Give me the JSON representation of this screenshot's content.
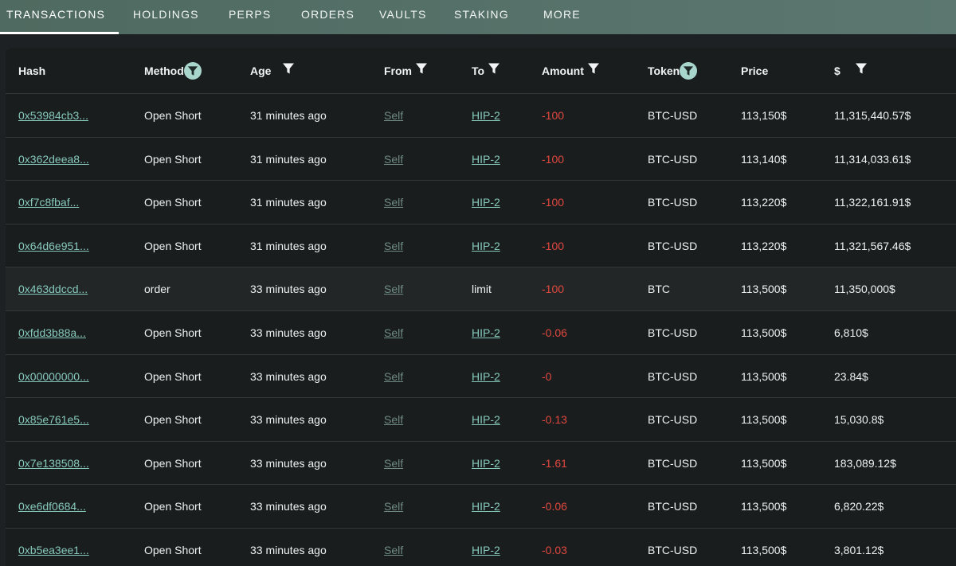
{
  "tabs": [
    {
      "label": "TRANSACTIONS",
      "active": true
    },
    {
      "label": "HOLDINGS",
      "active": false
    },
    {
      "label": "PERPS",
      "active": false
    },
    {
      "label": "ORDERS",
      "active": false
    },
    {
      "label": "VAULTS",
      "active": false
    },
    {
      "label": "STAKING",
      "active": false
    },
    {
      "label": "MORE",
      "active": false
    }
  ],
  "columns": [
    {
      "label": "Hash",
      "filter": "none"
    },
    {
      "label": "Method",
      "filter": "circle"
    },
    {
      "label": "Age",
      "filter": "plain"
    },
    {
      "label": "From",
      "filter": "plain"
    },
    {
      "label": "To",
      "filter": "plain"
    },
    {
      "label": "Amount",
      "filter": "plain"
    },
    {
      "label": "Token",
      "filter": "circle"
    },
    {
      "label": "Price",
      "filter": "none"
    },
    {
      "label": "$",
      "filter": "plain"
    }
  ],
  "rows": [
    {
      "hash": "0x53984cb3...",
      "method": "Open Short",
      "age": "31 minutes ago",
      "from": "Self",
      "to": "HIP-2",
      "to_link": true,
      "amount": "-100",
      "token": "BTC-USD",
      "price": "113,150$",
      "usd": "11,315,440.57$"
    },
    {
      "hash": "0x362deea8...",
      "method": "Open Short",
      "age": "31 minutes ago",
      "from": "Self",
      "to": "HIP-2",
      "to_link": true,
      "amount": "-100",
      "token": "BTC-USD",
      "price": "113,140$",
      "usd": "11,314,033.61$"
    },
    {
      "hash": "0xf7c8fbaf...",
      "method": "Open Short",
      "age": "31 minutes ago",
      "from": "Self",
      "to": "HIP-2",
      "to_link": true,
      "amount": "-100",
      "token": "BTC-USD",
      "price": "113,220$",
      "usd": "11,322,161.91$"
    },
    {
      "hash": "0x64d6e951...",
      "method": "Open Short",
      "age": "31 minutes ago",
      "from": "Self",
      "to": "HIP-2",
      "to_link": true,
      "amount": "-100",
      "token": "BTC-USD",
      "price": "113,220$",
      "usd": "11,321,567.46$"
    },
    {
      "hash": "0x463ddccd...",
      "method": "order",
      "age": "33 minutes ago",
      "from": "Self",
      "to": "limit",
      "to_link": false,
      "amount": "-100",
      "token": "BTC",
      "price": "113,500$",
      "usd": "11,350,000$"
    },
    {
      "hash": "0xfdd3b88a...",
      "method": "Open Short",
      "age": "33 minutes ago",
      "from": "Self",
      "to": "HIP-2",
      "to_link": true,
      "amount": "-0.06",
      "token": "BTC-USD",
      "price": "113,500$",
      "usd": "6,810$"
    },
    {
      "hash": "0x00000000...",
      "method": "Open Short",
      "age": "33 minutes ago",
      "from": "Self",
      "to": "HIP-2",
      "to_link": true,
      "amount": "-0",
      "token": "BTC-USD",
      "price": "113,500$",
      "usd": "23.84$"
    },
    {
      "hash": "0x85e761e5...",
      "method": "Open Short",
      "age": "33 minutes ago",
      "from": "Self",
      "to": "HIP-2",
      "to_link": true,
      "amount": "-0.13",
      "token": "BTC-USD",
      "price": "113,500$",
      "usd": "15,030.8$"
    },
    {
      "hash": "0x7e138508...",
      "method": "Open Short",
      "age": "33 minutes ago",
      "from": "Self",
      "to": "HIP-2",
      "to_link": true,
      "amount": "-1.61",
      "token": "BTC-USD",
      "price": "113,500$",
      "usd": "183,089.12$"
    },
    {
      "hash": "0xe6df0684...",
      "method": "Open Short",
      "age": "33 minutes ago",
      "from": "Self",
      "to": "HIP-2",
      "to_link": true,
      "amount": "-0.06",
      "token": "BTC-USD",
      "price": "113,500$",
      "usd": "6,820.22$"
    },
    {
      "hash": "0xb5ea3ee1...",
      "method": "Open Short",
      "age": "33 minutes ago",
      "from": "Self",
      "to": "HIP-2",
      "to_link": true,
      "amount": "-0.03",
      "token": "BTC-USD",
      "price": "113,500$",
      "usd": "3,801.12$"
    }
  ],
  "colors": {
    "tab_bar": "#557066",
    "link": "#86c9bb",
    "self_link": "#6f8a84",
    "negative": "#e0483f",
    "filter_active": "#a8d6cc"
  },
  "icons": {
    "filter": "funnel-icon",
    "filter_active": "funnel-active-icon"
  }
}
